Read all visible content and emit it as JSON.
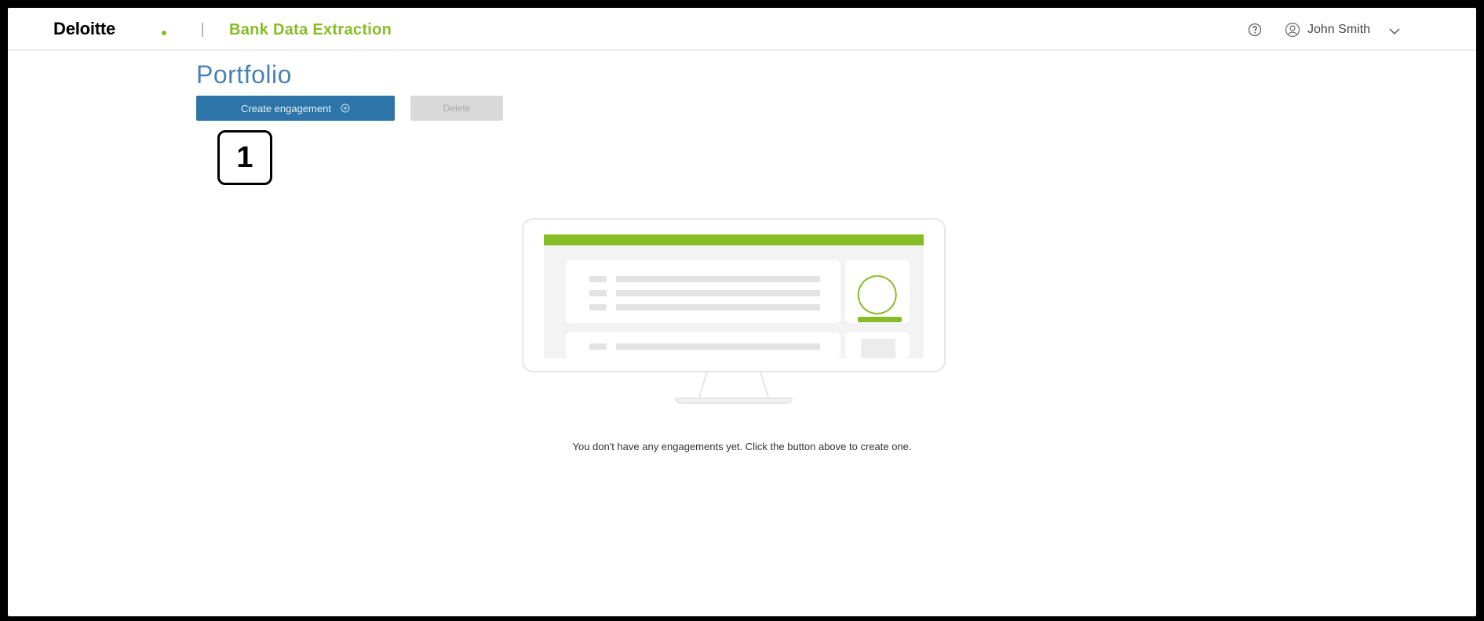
{
  "header": {
    "logo_text": "Deloitte",
    "app_title": "Bank Data Extraction",
    "help_icon": "help-circle-icon",
    "user_icon": "user-circle-icon",
    "user_name": "John Smith"
  },
  "main": {
    "page_title": "Portfolio",
    "create_button_label": "Create engagement",
    "create_button_icon": "plus-circle-icon",
    "delete_button_label": "Delete",
    "step_badge": "1",
    "empty_message": "You don't have any engagements yet. Click the button above to create one."
  },
  "colors": {
    "brand_green": "#86bc25",
    "title_blue": "#4a83b3",
    "button_blue": "#2d75a8",
    "disabled_gray": "#d9d9d9"
  }
}
